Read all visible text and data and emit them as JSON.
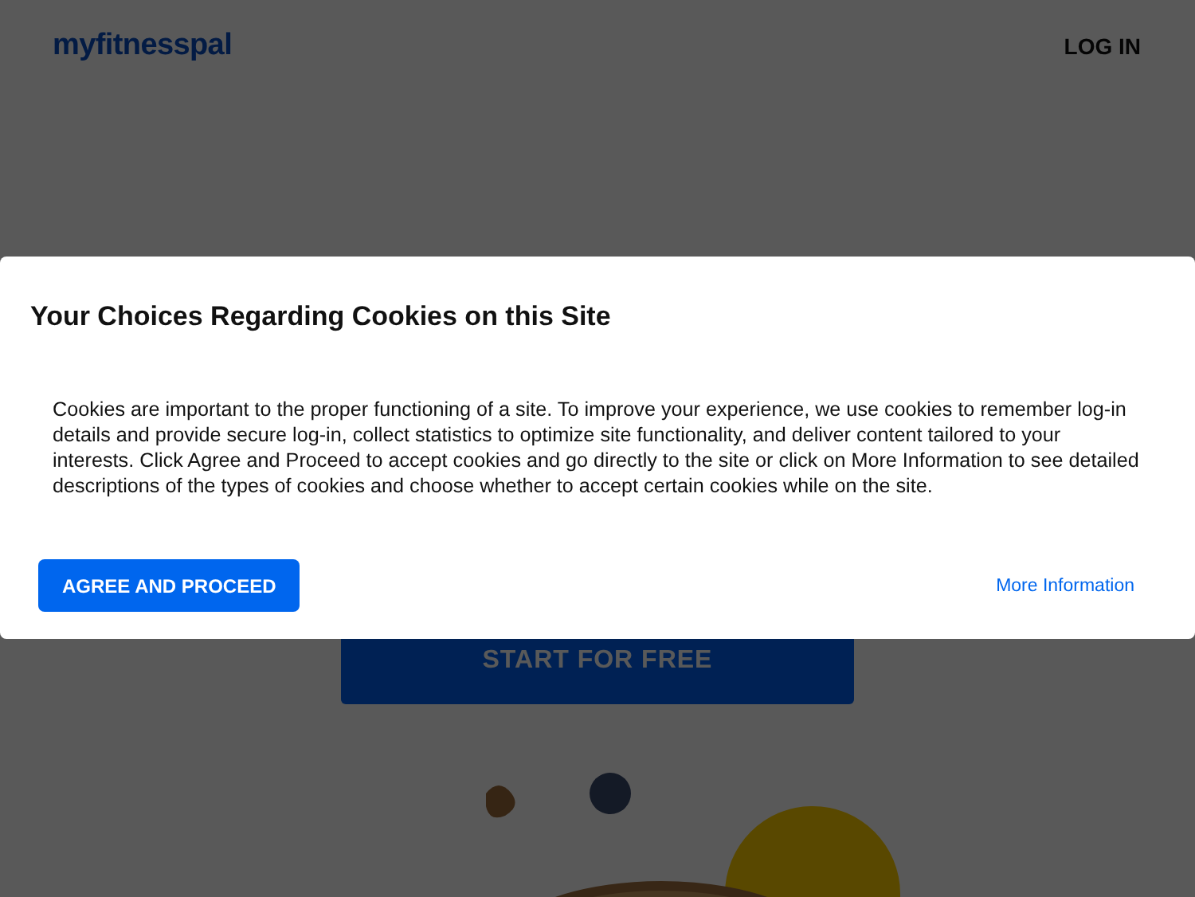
{
  "header": {
    "logo": "myfitnesspal",
    "login": "LOG IN"
  },
  "hero": {
    "cta": "START FOR FREE"
  },
  "cookie_dialog": {
    "title": "Your Choices Regarding Cookies on this Site",
    "body": "Cookies are important to the proper functioning of a site. To improve your experience, we use cookies to remember log-in details and provide secure log-in, collect statistics to optimize site functionality, and deliver content tailored to your interests. Click Agree and Proceed to accept cookies and go directly to the site or click on More Information to see detailed descriptions of the types of cookies and choose whether to accept certain cookies while on the site.",
    "agree_button": "AGREE AND PROCEED",
    "more_info_link": "More Information"
  }
}
